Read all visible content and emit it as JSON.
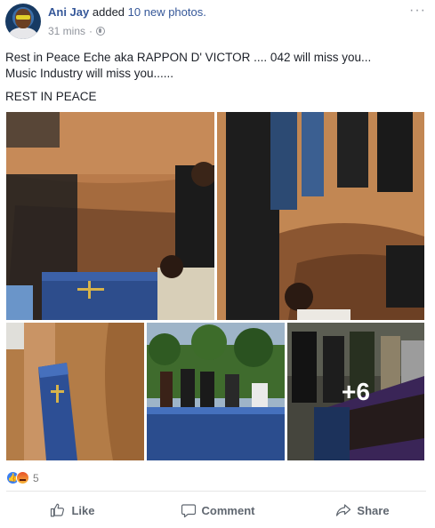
{
  "post": {
    "author": "Ani Jay",
    "action_text": "added",
    "photos_link": "10 new photos.",
    "time": "31 mins",
    "time_separator": "·",
    "menu_icon": "more-horizontal-icon",
    "privacy_icon": "globe-icon",
    "text_lines": [
      "Rest in Peace Eche aka RAPPON D' VICTOR .... 042 will miss you...",
      "Music Industry will miss you......"
    ],
    "text_line2": "REST IN PEACE"
  },
  "photos": {
    "more_count": "+6"
  },
  "reactions": {
    "icons": [
      "like-reaction-icon",
      "angry-reaction-icon"
    ],
    "count": "5"
  },
  "actions": {
    "like_label": "Like",
    "comment_label": "Comment",
    "share_label": "Share"
  },
  "colors": {
    "link": "#365899",
    "meta": "#90949c",
    "action": "#606770",
    "like_blue": "#3b7ff0"
  }
}
